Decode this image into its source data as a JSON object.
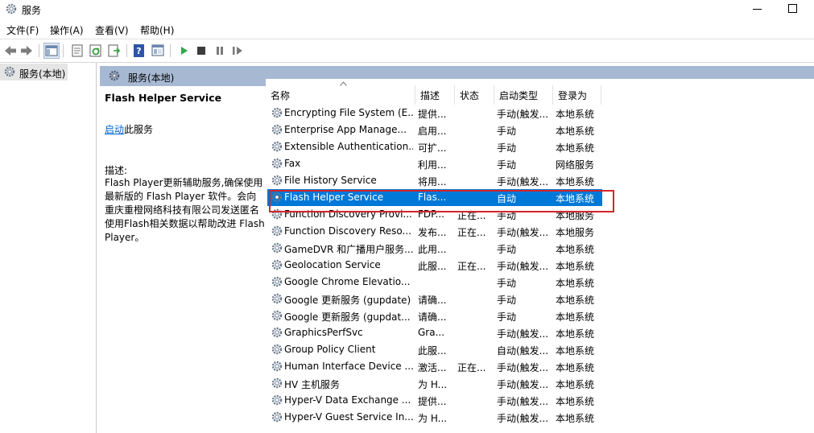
{
  "window": {
    "title": "服务"
  },
  "menu": [
    "文件(F)",
    "操作(A)",
    "查看(V)",
    "帮助(H)"
  ],
  "toolbar": {
    "buttons": [
      "back-icon",
      "forward-icon",
      "show-hide-tree-icon",
      "properties-icon",
      "refresh-icon",
      "export-list-icon",
      "help-icon",
      "console-icon",
      "start-icon",
      "stop-icon",
      "pause-icon",
      "restart-icon"
    ]
  },
  "tree": {
    "root_label": "服务(本地)"
  },
  "pane": {
    "header": "服务(本地)"
  },
  "detail": {
    "service_title": "Flash Helper Service",
    "start_link": "启动",
    "start_suffix": "此服务",
    "description_label": "描述:",
    "description": "Flash Player更新辅助服务,确保使用最新版的 Flash Player 软件。会向重庆重橙网络科技有限公司发送匿名使用Flash相关数据以帮助改进 Flash Player。"
  },
  "table": {
    "columns": [
      "名称",
      "描述",
      "状态",
      "启动类型",
      "登录为"
    ],
    "rows": [
      {
        "name": "Encrypting File System (E...",
        "desc": "提供...",
        "status": "",
        "startup": "手动(触发...",
        "logon": "本地系统"
      },
      {
        "name": "Enterprise App Manage...",
        "desc": "启用...",
        "status": "",
        "startup": "手动",
        "logon": "本地系统"
      },
      {
        "name": "Extensible Authentication...",
        "desc": "可扩...",
        "status": "",
        "startup": "手动",
        "logon": "本地系统"
      },
      {
        "name": "Fax",
        "desc": "利用...",
        "status": "",
        "startup": "手动",
        "logon": "网络服务"
      },
      {
        "name": "File History Service",
        "desc": "将用...",
        "status": "",
        "startup": "手动(触发...",
        "logon": "本地系统"
      },
      {
        "name": "Flash Helper Service",
        "desc": "Flas...",
        "status": "",
        "startup": "自动",
        "logon": "本地系统"
      },
      {
        "name": "Function Discovery Provi...",
        "desc": "FDP...",
        "status": "正在...",
        "startup": "手动",
        "logon": "本地服务"
      },
      {
        "name": "Function Discovery Reso...",
        "desc": "发布...",
        "status": "正在...",
        "startup": "手动(触发...",
        "logon": "本地服务"
      },
      {
        "name": "GameDVR 和广播用户服务...",
        "desc": "此用...",
        "status": "",
        "startup": "手动",
        "logon": "本地系统"
      },
      {
        "name": "Geolocation Service",
        "desc": "此服...",
        "status": "正在...",
        "startup": "手动(触发...",
        "logon": "本地系统"
      },
      {
        "name": "Google Chrome Elevatio...",
        "desc": "",
        "status": "",
        "startup": "手动",
        "logon": "本地系统"
      },
      {
        "name": "Google 更新服务 (gupdate)",
        "desc": "请确...",
        "status": "",
        "startup": "手动",
        "logon": "本地系统"
      },
      {
        "name": "Google 更新服务 (gupdat...",
        "desc": "请确...",
        "status": "",
        "startup": "手动",
        "logon": "本地系统"
      },
      {
        "name": "GraphicsPerfSvc",
        "desc": "Gra...",
        "status": "",
        "startup": "手动(触发...",
        "logon": "本地系统"
      },
      {
        "name": "Group Policy Client",
        "desc": "此服...",
        "status": "",
        "startup": "自动(触发...",
        "logon": "本地系统"
      },
      {
        "name": "Human Interface Device ...",
        "desc": "激活...",
        "status": "正在...",
        "startup": "手动(触发...",
        "logon": "本地系统"
      },
      {
        "name": "HV 主机服务",
        "desc": "为 H...",
        "status": "",
        "startup": "手动(触发...",
        "logon": "本地系统"
      },
      {
        "name": "Hyper-V Data Exchange ...",
        "desc": "提供...",
        "status": "",
        "startup": "手动(触发...",
        "logon": "本地系统"
      },
      {
        "name": "Hyper-V Guest Service In...",
        "desc": "为 H...",
        "status": "",
        "startup": "手动(触发...",
        "logon": "本地系统"
      }
    ],
    "selected_index": 5
  },
  "colors": {
    "selection": "#0078d7",
    "pane_header": "#a7b8d3",
    "highlight_border": "#d4262b",
    "link": "#0066cc"
  }
}
